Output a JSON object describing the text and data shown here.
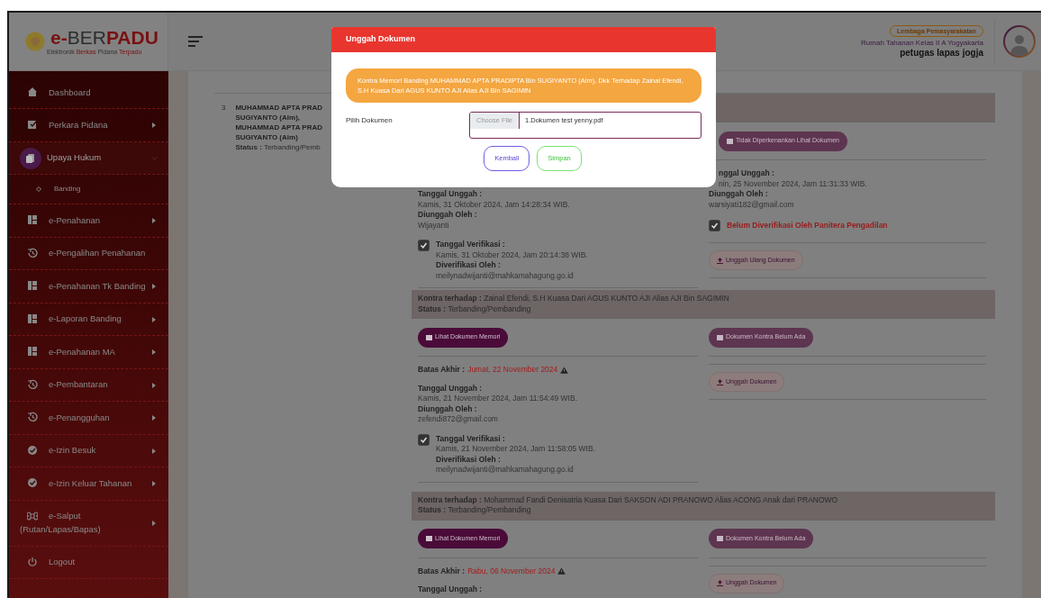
{
  "header": {
    "logo": {
      "title_parts": [
        {
          "text": "e-",
          "accent": true
        },
        {
          "text": "BER",
          "accent": false
        },
        {
          "text": "PADU",
          "accent": true
        }
      ],
      "subtitle_parts": [
        {
          "text": "Elektronik ",
          "accent": false
        },
        {
          "text": "Berkas ",
          "accent": true
        },
        {
          "text": "Pidana ",
          "accent": false
        },
        {
          "text": "Terpadu",
          "accent": true
        }
      ]
    },
    "institution_badge": "Lembaga Pemasyarakatan",
    "institution": "Rumah Tahanan Kelas II A Yogyakarta",
    "user": "petugas lapas jogja"
  },
  "sidebar": {
    "items": [
      {
        "label": "Dashboard",
        "has_submenu": false,
        "expanded": false,
        "selected": false
      },
      {
        "label": "Perkara Pidana",
        "has_submenu": true,
        "expanded": false,
        "selected": false
      },
      {
        "label": "Upaya Hukum",
        "has_submenu": true,
        "expanded": true,
        "selected": true,
        "children": [
          {
            "label": "Banding"
          }
        ]
      },
      {
        "label": "e-Penahanan",
        "has_submenu": true,
        "expanded": false,
        "selected": false
      },
      {
        "label": "e-Pengalihan Penahanan",
        "has_submenu": false,
        "expanded": false,
        "selected": false
      },
      {
        "label": "e-Penahanan Tk Banding",
        "has_submenu": true,
        "expanded": false,
        "selected": false
      },
      {
        "label": "e-Laporan Banding",
        "has_submenu": true,
        "expanded": false,
        "selected": false
      },
      {
        "label": "e-Penahanan MA",
        "has_submenu": true,
        "expanded": false,
        "selected": false
      },
      {
        "label": "e-Pembantaran",
        "has_submenu": true,
        "expanded": false,
        "selected": false
      },
      {
        "label": "e-Penangguhan",
        "has_submenu": true,
        "expanded": false,
        "selected": false
      },
      {
        "label": "e-Izin Besuk",
        "has_submenu": true,
        "expanded": false,
        "selected": false
      },
      {
        "label": "e-Izin Keluar Tahanan",
        "has_submenu": true,
        "expanded": false,
        "selected": false
      },
      {
        "label": "e-Salput (Rutan/Lapas/Bapas)",
        "has_submenu": true,
        "expanded": false,
        "selected": false
      },
      {
        "label": "Logout",
        "has_submenu": false,
        "expanded": false,
        "selected": false
      }
    ]
  },
  "row": {
    "number": "3",
    "name_lines": [
      "MUHAMMAD APTA PRAD",
      "SUGIYANTO (Alm),",
      "MUHAMMAD APTA PRAD",
      "SUGIYANTO (Alm)"
    ],
    "status": "**Status :** Terbanding/Pemb"
  },
  "sections": [
    {
      "right_button": {
        "label": "Tidak Diperkenankan Lihat Dokumen"
      },
      "left": [
        {
          "kind": "upload",
          "date_label": "Tanggal Unggah :",
          "date": "Kamis, 31 Oktober 2024, Jam 14:28:34 WIB.",
          "by_label": "Diunggah Oleh :",
          "by": "Wijayanti"
        },
        {
          "kind": "verified",
          "checked": true,
          "date_label": "Tanggal Verifikasi :",
          "date": "Kamis, 31 Oktober 2024, Jam 20:14:38 WIB.",
          "by_label": "Diverifikasi Oleh :",
          "by": "meilynadwijanti@mahkamahagung.go.id"
        }
      ],
      "right": [
        {
          "kind": "upload",
          "date_label": "nggal Unggah :",
          "date": "nin, 25 November 2024, Jam 11:31:33 WIB.",
          "by_label": "Diunggah Oleh :",
          "by": "warsiyati182@gmail.com"
        },
        {
          "kind": "unverified",
          "checked": true,
          "text": "Belum Diverifikasi Oleh Panitera Pengadilan"
        },
        {
          "kind": "action",
          "label": "Unggah Ulang Dokumen"
        }
      ]
    },
    {
      "header": {
        "kontra": "**Kontra terhadap :** Zainal Efendi, S.H Kuasa Dari AGUS KUNTO AJI Alias AJI Bin SAGIMIN",
        "status": "**Status :** Terbanding/Pembanding"
      },
      "left_button": {
        "label": "Lihat Dokumen Memori"
      },
      "right_button": {
        "label": "Dokumen Kontra Belum Ada"
      },
      "left": [
        {
          "kind": "deadline",
          "label": "Batas Akhir :",
          "value": "Jumat, 22 November 2024"
        },
        {
          "kind": "upload",
          "date_label": "Tanggal Unggah :",
          "date": "Kamis, 21 November 2024, Jam 11:54:49 WIB.",
          "by_label": "Diunggah Oleh :",
          "by": "zefendi872@gmail.com"
        },
        {
          "kind": "verified",
          "checked": true,
          "date_label": "Tanggal Verifikasi :",
          "date": "Kamis, 21 November 2024, Jam 11:58:05 WIB.",
          "by_label": "Diverifikasi Oleh :",
          "by": "meilynadwijanti@mahkamahagung.go.id"
        }
      ],
      "right": [
        {
          "kind": "action",
          "label": "Unggah Dokumen"
        }
      ]
    },
    {
      "header": {
        "kontra": "**Kontra terhadap :** Mohammad Fandi Denisatria Kuasa Dari SAKSON ADI PRANOWO Alias ACONG Anak dari PRANOWO",
        "status": "**Status :** Terbanding/Pembanding"
      },
      "left_button": {
        "label": "Lihat Dokumen Memori"
      },
      "right_button": {
        "label": "Dokumen Kontra Belum Ada"
      },
      "left": [
        {
          "kind": "deadline",
          "label": "Batas Akhir :",
          "value": "Rabu, 06 November 2024"
        },
        {
          "kind": "upload",
          "date_label": "Tanggal Unggah :"
        }
      ],
      "right": [
        {
          "kind": "action",
          "label": "Unggah Dokumen"
        }
      ]
    }
  ],
  "modal": {
    "title": "Unggah Dokumen",
    "notice": "Kontra Memori Banding MUHAMMAD APTA PRADIPTA Bin SUGIYANTO (Alm), Dkk Terhadap Zainal Efendi, S.H Kuasa Dari AGUS KUNTO AJI Alias AJI Bin SAGIMIN",
    "field_label": "Pilih Dokumen",
    "file_button": "Choose File",
    "file_name": "1.Dokumen test yenny.pdf",
    "buttons": [
      {
        "label": "Kembali",
        "kind": "back"
      },
      {
        "label": "Simpan",
        "kind": "save"
      }
    ]
  }
}
